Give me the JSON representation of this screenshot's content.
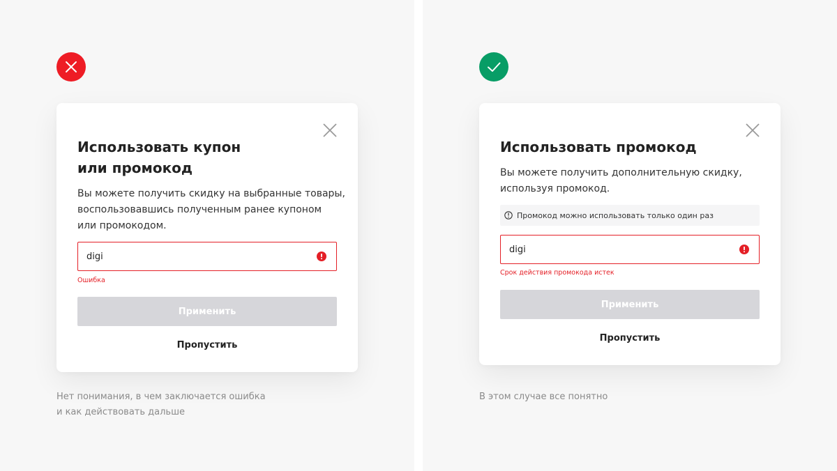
{
  "colors": {
    "error_red": "#e41f26",
    "badge_bad": "#ee1c25",
    "badge_good": "#089d66",
    "button_disabled": "#d6d6da",
    "panel_bg": "#f7f7f7"
  },
  "bad_example": {
    "badge_icon": "cross-icon",
    "dialog": {
      "close_icon": "close-icon",
      "title": "Использовать купон\nили промокод",
      "description": "Вы можете получить скидку на выбранные товары,\nвоспользовавшись полученным ранее купоном\nили промокодом.",
      "input_value": "digi",
      "error_icon": "error-circle-icon",
      "error_text": "Ошибка",
      "apply_label": "Применить",
      "skip_label": "Пропустить"
    },
    "caption": "Нет понимания, в чем заключается ошибка\nи как действовать дальше"
  },
  "good_example": {
    "badge_icon": "checkmark-icon",
    "dialog": {
      "close_icon": "close-icon",
      "title": "Использовать промокод",
      "description": "Вы можете получить дополнительную скидку,\nиспользуя промокод.",
      "info_icon": "info-icon",
      "info_text": "Промокод можно использовать только один раз",
      "input_value": "digi",
      "error_icon": "error-circle-icon",
      "error_text": "Срок действия промокода истек",
      "apply_label": "Применить",
      "skip_label": "Пропустить"
    },
    "caption": "В этом случае все понятно"
  }
}
